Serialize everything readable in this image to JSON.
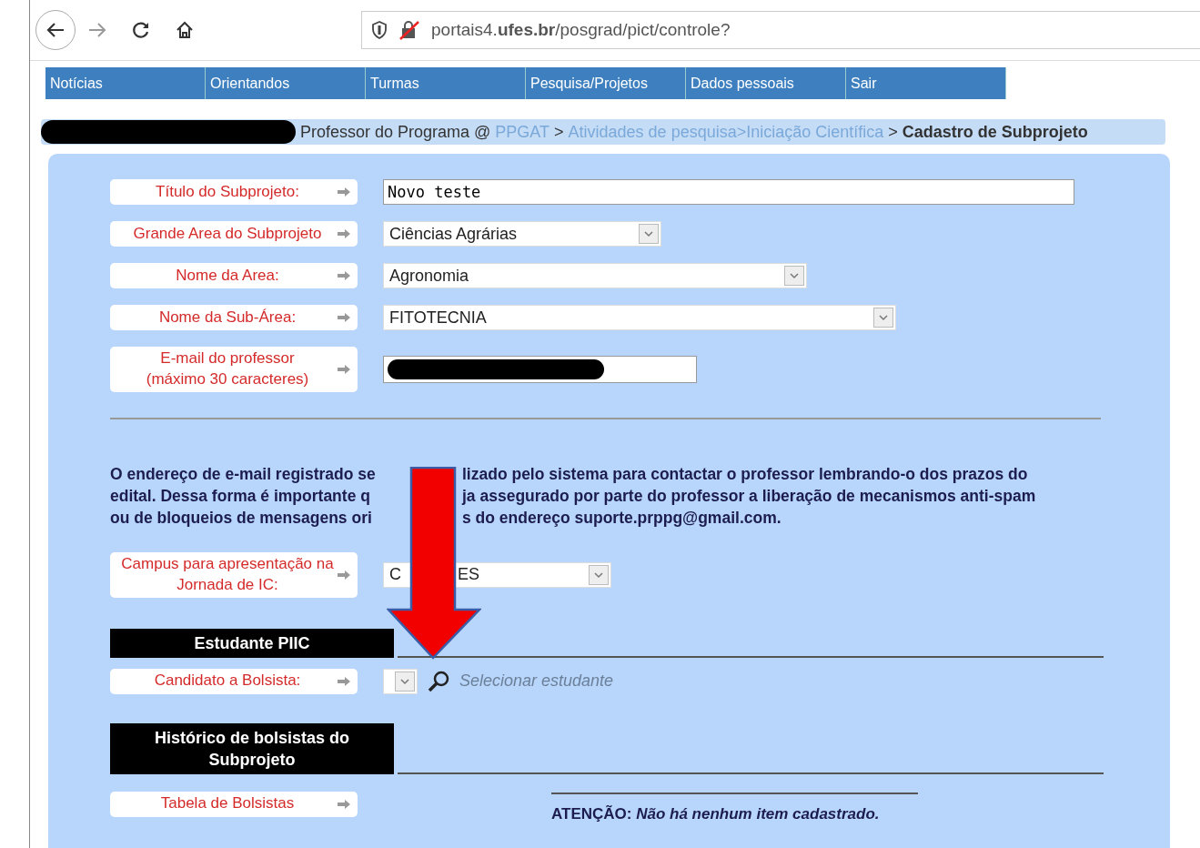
{
  "browser": {
    "url": "portais4.**ufes.br**/posgrad/pict/controle?"
  },
  "nav": [
    {
      "label": "Notícias"
    },
    {
      "label": "Orientandos"
    },
    {
      "label": "Turmas"
    },
    {
      "label": "Pesquisa/Projetos"
    },
    {
      "label": "Dados pessoais"
    },
    {
      "label": "Sair"
    }
  ],
  "breadcrumb": [
    {
      "kind": "redacted"
    },
    {
      "kind": "text",
      "text": "Professor do Programa @"
    },
    {
      "kind": "link",
      "text": "PPGAT"
    },
    {
      "kind": "text",
      "text": ">"
    },
    {
      "kind": "link",
      "text": "Atividades de pesquisa>Iniciação Científica"
    },
    {
      "kind": "text",
      "text": ">"
    },
    {
      "kind": "current",
      "text": "Cadastro de Subprojeto"
    }
  ],
  "fields": [
    {
      "label": "Título do Subprojeto:",
      "kind": "text",
      "value": "Novo teste"
    },
    {
      "label": "Grande Area do Subprojeto",
      "kind": "select",
      "value": "Ciências Agrárias"
    },
    {
      "label": "Nome da Area:",
      "kind": "select",
      "value": "Agronomia"
    },
    {
      "label": "Nome da Sub-Área:",
      "kind": "select",
      "value": "FITOTECNIA"
    },
    {
      "label": "E-mail do professor\n(máximo 30 caracteres)",
      "kind": "redacted"
    }
  ],
  "notice_lines": [
    {
      "left": "O endereço de e-mail registrado se",
      "right": "lizado pelo sistema para contactar o professor lembrando-o dos prazos do"
    },
    {
      "left": "edital. Dessa forma é importante q",
      "right": "ja assegurado por parte do professor a liberação de mecanismos anti-spam"
    },
    {
      "left": "ou de bloqueios de mensagens ori",
      "right": "s do endereço **suporte.prppg@gmail.com.**"
    }
  ],
  "campus": {
    "label": "Campus para apresentação na Jornada de IC:",
    "value_left": "C",
    "value_right": "ES"
  },
  "student_section": {
    "title": "Estudante PIIC",
    "label": "Candidato a Bolsista:",
    "link": "Selecionar estudante"
  },
  "history_section": {
    "title": "Histórico de bolsistas do Subprojeto",
    "label": "Tabela de Bolsistas",
    "message": "ATENÇÃO: *Não há nenhum item cadastrado.*"
  }
}
